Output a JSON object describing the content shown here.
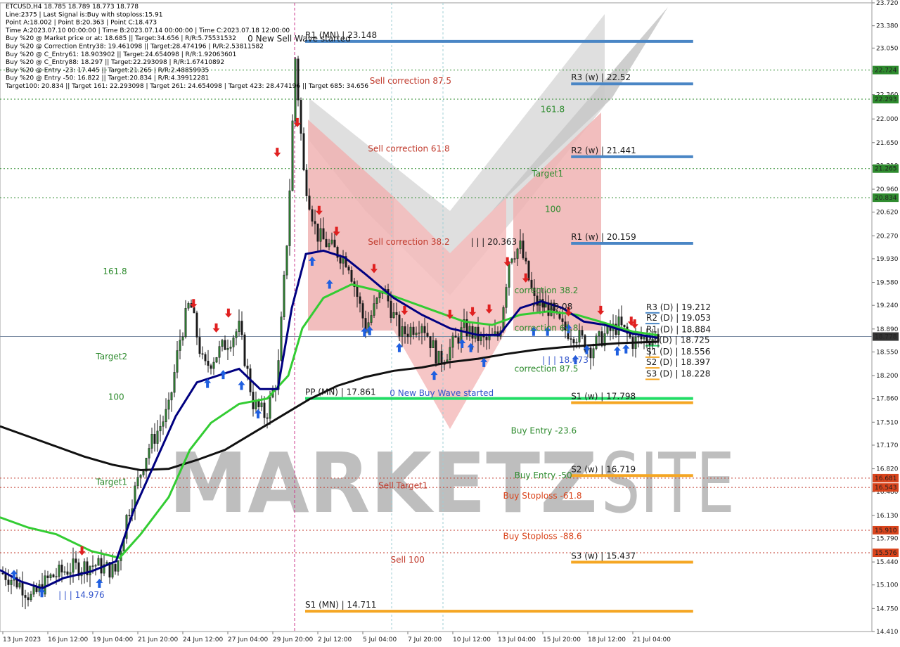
{
  "info": {
    "lines": [
      "ETCUSD,H4  18.785 18.789 18.773 18.778",
      "Line:2375 | Last Signal is:Buy with stoploss:15.91",
      "Point A:18.002 | Point B:20.363 | Point C:18.473",
      "Time A:2023.07.10 00:00:00 | Time B:2023.07.14 00:00:00 | Time C:2023.07.18 12:00:00",
      "Buy %20 @ Market price or at: 18.685 || Target:34.656 | R/R:5.75531532",
      "Buy %20 @ Correction Entry38: 19.461098 || Target:28.474196 | R/R:2.53811582",
      "Buy %20 @ C_Entry61: 18.903902 || Target:24.654098 | R/R:1.92063601",
      "Buy %20 @ C_Entry88: 18.297 || Target:22.293098 | R/R:1.67410892",
      "Buy %20 @ Entry -23: 17.445 || Target:21.265 | R/R:2.48859935",
      "Buy %20 @ Entry -50: 16.822 || Target:20.834 | R/R:4.39912281",
      "Target100: 20.834 || Target 161: 22.293098 | Target 261: 24.654098 | Target 423: 28.474196 || Target 685: 34.656"
    ]
  },
  "chart_data": {
    "type": "candlestick",
    "symbol": "ETCUSD",
    "timeframe": "H4",
    "last_price": 18.778,
    "ylim": [
      14.41,
      23.72
    ],
    "y_ticks": [
      "23.720",
      "23.380",
      "23.050",
      "22.710",
      "22.360",
      "22.000",
      "21.650",
      "21.310",
      "20.960",
      "20.620",
      "20.270",
      "19.930",
      "19.580",
      "19.240",
      "18.890",
      "18.550",
      "18.200",
      "17.860",
      "17.510",
      "17.170",
      "16.820",
      "16.480",
      "16.130",
      "15.790",
      "15.440",
      "15.100",
      "14.750",
      "14.410"
    ],
    "x_ticks": [
      "13 Jun 2023",
      "16 Jun 12:00",
      "19 Jun 04:00",
      "21 Jun 20:00",
      "24 Jun 12:00",
      "27 Jun 04:00",
      "29 Jun 20:00",
      "2 Jul 12:00",
      "5 Jul 04:00",
      "7 Jul 20:00",
      "10 Jul 12:00",
      "13 Jul 04:00",
      "15 Jul 20:00",
      "18 Jul 12:00",
      "21 Jul 04:00"
    ],
    "price_tags": [
      {
        "price": 22.724,
        "label": "22.724",
        "color": "#2e8b2e"
      },
      {
        "price": 22.293,
        "label": "22.293",
        "color": "#2e8b2e"
      },
      {
        "price": 21.265,
        "label": "21.265",
        "color": "#2e8b2e"
      },
      {
        "price": 20.834,
        "label": "20.834",
        "color": "#2e8b2e"
      },
      {
        "price": 18.778,
        "label": "18.778",
        "color": "#333333"
      },
      {
        "price": 16.681,
        "label": "16.681",
        "color": "#d9441c"
      },
      {
        "price": 16.543,
        "label": "16.543",
        "color": "#d9441c"
      },
      {
        "price": 15.91,
        "label": "15.910",
        "color": "#d9441c"
      },
      {
        "price": 15.576,
        "label": "15.576",
        "color": "#d9441c"
      }
    ],
    "dotted_levels": [
      {
        "price": 22.724,
        "color": "#2e8b2e"
      },
      {
        "price": 22.293,
        "color": "#2e8b2e"
      },
      {
        "price": 21.265,
        "color": "#2e8b2e"
      },
      {
        "price": 20.834,
        "color": "#2e8b2e"
      },
      {
        "price": 16.681,
        "color": "#c0392b"
      },
      {
        "price": 16.543,
        "color": "#c0392b"
      },
      {
        "price": 15.91,
        "color": "#c0392b"
      },
      {
        "price": 15.576,
        "color": "#c0392b"
      }
    ],
    "pivot_lines": [
      {
        "label": "R1 (MN) | 23.148",
        "price": 23.148,
        "color": "#4a86c5",
        "x1_frac": 0.35,
        "x2_frac": 0.795
      },
      {
        "label": "R3 (w) | 22.52",
        "price": 22.52,
        "color": "#4a86c5",
        "x1_frac": 0.655,
        "x2_frac": 0.795
      },
      {
        "label": "R2 (w) | 21.441",
        "price": 21.441,
        "color": "#4a86c5",
        "x1_frac": 0.655,
        "x2_frac": 0.795
      },
      {
        "label": "R1 (w) | 20.159",
        "price": 20.159,
        "color": "#4a86c5",
        "x1_frac": 0.655,
        "x2_frac": 0.795
      },
      {
        "label": "PP (MN) | 17.861",
        "price": 17.861,
        "color": "#22dd66",
        "x1_frac": 0.35,
        "x2_frac": 0.795
      },
      {
        "label": "S1 (w) | 17.798",
        "price": 17.798,
        "color": "#f5a623",
        "x1_frac": 0.655,
        "x2_frac": 0.795
      },
      {
        "label": "S2 (w) | 16.719",
        "price": 16.719,
        "color": "#f5a623",
        "x1_frac": 0.655,
        "x2_frac": 0.795
      },
      {
        "label": "S3 (w) | 15.437",
        "price": 15.437,
        "color": "#f5a623",
        "x1_frac": 0.655,
        "x2_frac": 0.795
      },
      {
        "label": "S1 (MN) | 14.711",
        "price": 14.711,
        "color": "#f5a623",
        "x1_frac": 0.35,
        "x2_frac": 0.795
      }
    ],
    "daily_pivots": [
      {
        "label": "R3 (D) | 19.212",
        "price": 19.212
      },
      {
        "label": "R2 (D) | 19.053",
        "price": 19.053
      },
      {
        "label": "R1 (D) | 18.884",
        "price": 18.884
      },
      {
        "label": "PP (D) | 18.725",
        "price": 18.725
      },
      {
        "label": "S1 (D) | 18.556",
        "price": 18.556
      },
      {
        "label": "S2 (D) | 18.397",
        "price": 18.397
      },
      {
        "label": "S3 (D) | 18.228",
        "price": 18.228
      }
    ],
    "annotations": [
      {
        "text": "0 New Sell Wave started",
        "color": "#1a1a1a",
        "price": 23.148,
        "x_frac": 0.284
      },
      {
        "text": "Sell correction 87.5",
        "color": "#c0392b",
        "price": 22.52,
        "x_frac": 0.424
      },
      {
        "text": "Sell correction 61.8",
        "color": "#c0392b",
        "price": 21.52,
        "x_frac": 0.422
      },
      {
        "text": "Sell correction 38.2",
        "color": "#c0392b",
        "price": 20.14,
        "x_frac": 0.422
      },
      {
        "text": "161.8",
        "color": "#2e8b2e",
        "price": 22.1,
        "x_frac": 0.62
      },
      {
        "text": "Target1",
        "color": "#2e8b2e",
        "price": 21.15,
        "x_frac": 0.61
      },
      {
        "text": "100",
        "color": "#2e8b2e",
        "price": 20.62,
        "x_frac": 0.625
      },
      {
        "text": "| | | 20.363",
        "color": "#1a1a1a",
        "price": 20.14,
        "x_frac": 0.54
      },
      {
        "text": "correction 38.2",
        "color": "#2e8b2e",
        "price": 19.42,
        "x_frac": 0.59
      },
      {
        "text": "correction 61.8",
        "color": "#2e8b2e",
        "price": 18.86,
        "x_frac": 0.59
      },
      {
        "text": "correction 87.5",
        "color": "#2e8b2e",
        "price": 18.26,
        "x_frac": 0.59
      },
      {
        "text": "| | | 18.473",
        "color": "#3355cc",
        "price": 18.39,
        "x_frac": 0.622
      },
      {
        "text": "| | | 19.08",
        "color": "#1a1a1a",
        "price": 19.18,
        "x_frac": 0.61
      },
      {
        "text": "0 New Buy Wave started",
        "color": "#3355cc",
        "price": 17.9,
        "x_frac": 0.447
      },
      {
        "text": "Buy Entry -23.6",
        "color": "#2e8b2e",
        "price": 17.34,
        "x_frac": 0.586
      },
      {
        "text": "Buy Entry -50",
        "color": "#2e8b2e",
        "price": 16.68,
        "x_frac": 0.59
      },
      {
        "text": "Buy Stoploss -61.8",
        "color": "#d9441c",
        "price": 16.38,
        "x_frac": 0.577
      },
      {
        "text": "Buy Stoploss -88.6",
        "color": "#d9441c",
        "price": 15.78,
        "x_frac": 0.577
      },
      {
        "text": "Sell Target1",
        "color": "#c0392b",
        "price": 16.53,
        "x_frac": 0.434
      },
      {
        "text": "Sell 100",
        "color": "#c0392b",
        "price": 15.43,
        "x_frac": 0.448
      },
      {
        "text": "161.8",
        "color": "#2e8b2e",
        "price": 19.7,
        "x_frac": 0.118
      },
      {
        "text": "Target2",
        "color": "#2e8b2e",
        "price": 18.44,
        "x_frac": 0.11
      },
      {
        "text": "100",
        "color": "#2e8b2e",
        "price": 17.84,
        "x_frac": 0.124
      },
      {
        "text": "Target1",
        "color": "#2e8b2e",
        "price": 16.58,
        "x_frac": 0.11
      },
      {
        "text": "| | | 14.976",
        "color": "#3355cc",
        "price": 14.91,
        "x_frac": 0.067
      }
    ],
    "watermark": {
      "text_bold": "MARKETZ",
      "text_light": "SITE"
    },
    "sell_arrows_frac": [
      [
        0.094,
        15.6
      ],
      [
        0.222,
        19.26
      ],
      [
        0.248,
        18.9
      ],
      [
        0.262,
        19.12
      ],
      [
        0.318,
        21.5
      ],
      [
        0.341,
        21.94
      ],
      [
        0.366,
        20.64
      ],
      [
        0.386,
        20.33
      ],
      [
        0.429,
        19.78
      ],
      [
        0.464,
        19.16
      ],
      [
        0.516,
        19.1
      ],
      [
        0.542,
        19.14
      ],
      [
        0.561,
        19.18
      ],
      [
        0.582,
        19.88
      ],
      [
        0.603,
        19.64
      ],
      [
        0.652,
        19.14
      ],
      [
        0.689,
        19.16
      ],
      [
        0.724,
        19.0
      ],
      [
        0.728,
        18.96
      ]
    ],
    "buy_arrows_frac": [
      [
        0.016,
        15.26
      ],
      [
        0.048,
        14.99
      ],
      [
        0.114,
        15.13
      ],
      [
        0.238,
        18.09
      ],
      [
        0.256,
        18.22
      ],
      [
        0.277,
        18.06
      ],
      [
        0.296,
        17.64
      ],
      [
        0.358,
        19.9
      ],
      [
        0.378,
        19.56
      ],
      [
        0.418,
        18.85
      ],
      [
        0.424,
        18.87
      ],
      [
        0.458,
        18.62
      ],
      [
        0.498,
        18.21
      ],
      [
        0.53,
        18.68
      ],
      [
        0.54,
        18.62
      ],
      [
        0.555,
        18.4
      ],
      [
        0.612,
        18.86
      ],
      [
        0.628,
        18.86
      ],
      [
        0.652,
        18.9
      ],
      [
        0.66,
        18.44
      ],
      [
        0.673,
        18.59
      ],
      [
        0.708,
        18.57
      ],
      [
        0.718,
        18.6
      ]
    ],
    "series": [
      {
        "name": "",
        "color": "#000080",
        "role": "fast MA"
      },
      {
        "name": "",
        "color": "#33cc33",
        "role": "medium MA"
      },
      {
        "name": "",
        "color": "#111111",
        "role": "slow MA"
      }
    ]
  }
}
